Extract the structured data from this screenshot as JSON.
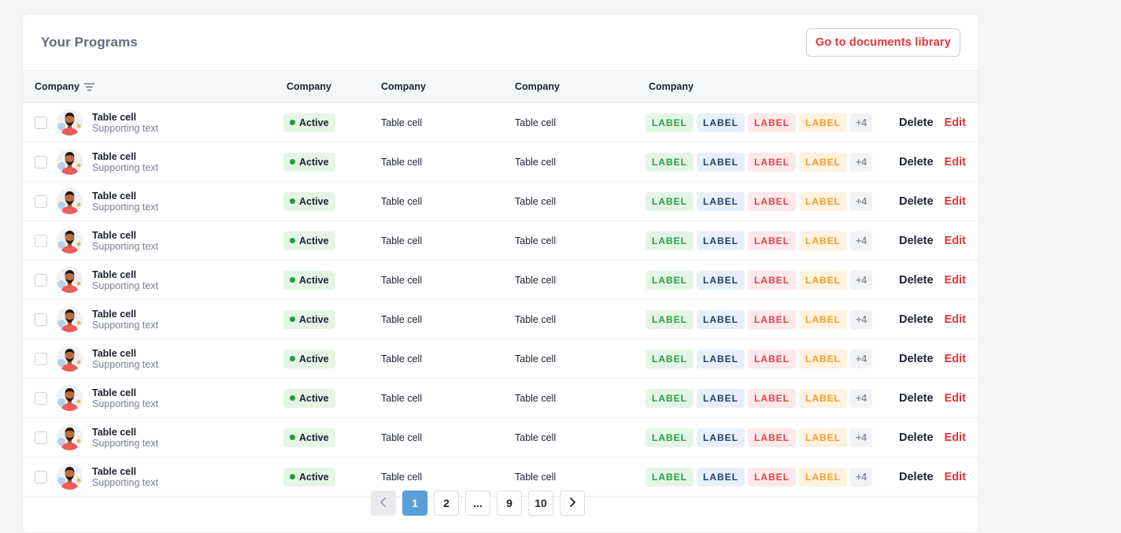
{
  "header": {
    "title": "Your Programs",
    "library_button": "Go to documents library"
  },
  "columns": [
    "Company",
    "Company",
    "Company",
    "Company",
    "Company"
  ],
  "rows": [
    {
      "name": "Table cell",
      "sub": "Supporting text",
      "status": "Active",
      "col3": "Table cell",
      "col4": "Table cell",
      "tags": [
        "LABEL",
        "LABEL",
        "LABEL",
        "LABEL"
      ],
      "more": "+4",
      "delete": "Delete",
      "edit": "Edit"
    },
    {
      "name": "Table cell",
      "sub": "Supporting text",
      "status": "Active",
      "col3": "Table cell",
      "col4": "Table cell",
      "tags": [
        "LABEL",
        "LABEL",
        "LABEL",
        "LABEL"
      ],
      "more": "+4",
      "delete": "Delete",
      "edit": "Edit"
    },
    {
      "name": "Table cell",
      "sub": "Supporting text",
      "status": "Active",
      "col3": "Table cell",
      "col4": "Table cell",
      "tags": [
        "LABEL",
        "LABEL",
        "LABEL",
        "LABEL"
      ],
      "more": "+4",
      "delete": "Delete",
      "edit": "Edit"
    },
    {
      "name": "Table cell",
      "sub": "Supporting text",
      "status": "Active",
      "col3": "Table cell",
      "col4": "Table cell",
      "tags": [
        "LABEL",
        "LABEL",
        "LABEL",
        "LABEL"
      ],
      "more": "+4",
      "delete": "Delete",
      "edit": "Edit"
    },
    {
      "name": "Table cell",
      "sub": "Supporting text",
      "status": "Active",
      "col3": "Table cell",
      "col4": "Table cell",
      "tags": [
        "LABEL",
        "LABEL",
        "LABEL",
        "LABEL"
      ],
      "more": "+4",
      "delete": "Delete",
      "edit": "Edit"
    },
    {
      "name": "Table cell",
      "sub": "Supporting text",
      "status": "Active",
      "col3": "Table cell",
      "col4": "Table cell",
      "tags": [
        "LABEL",
        "LABEL",
        "LABEL",
        "LABEL"
      ],
      "more": "+4",
      "delete": "Delete",
      "edit": "Edit"
    },
    {
      "name": "Table cell",
      "sub": "Supporting text",
      "status": "Active",
      "col3": "Table cell",
      "col4": "Table cell",
      "tags": [
        "LABEL",
        "LABEL",
        "LABEL",
        "LABEL"
      ],
      "more": "+4",
      "delete": "Delete",
      "edit": "Edit"
    },
    {
      "name": "Table cell",
      "sub": "Supporting text",
      "status": "Active",
      "col3": "Table cell",
      "col4": "Table cell",
      "tags": [
        "LABEL",
        "LABEL",
        "LABEL",
        "LABEL"
      ],
      "more": "+4",
      "delete": "Delete",
      "edit": "Edit"
    },
    {
      "name": "Table cell",
      "sub": "Supporting text",
      "status": "Active",
      "col3": "Table cell",
      "col4": "Table cell",
      "tags": [
        "LABEL",
        "LABEL",
        "LABEL",
        "LABEL"
      ],
      "more": "+4",
      "delete": "Delete",
      "edit": "Edit"
    },
    {
      "name": "Table cell",
      "sub": "Supporting text",
      "status": "Active",
      "col3": "Table cell",
      "col4": "Table cell",
      "tags": [
        "LABEL",
        "LABEL",
        "LABEL",
        "LABEL"
      ],
      "more": "+4",
      "delete": "Delete",
      "edit": "Edit"
    }
  ],
  "tag_colors": [
    "green",
    "blue",
    "red",
    "orange"
  ],
  "pagination": {
    "pages": [
      "1",
      "2",
      "...",
      "9",
      "10"
    ],
    "current": "1",
    "prev_icon": "chevron-left-icon",
    "next_icon": "chevron-right-icon"
  },
  "colors": {
    "accent_red": "#e5333b",
    "status_green": "#1f9d3e",
    "page_active": "#5b9fd8"
  }
}
